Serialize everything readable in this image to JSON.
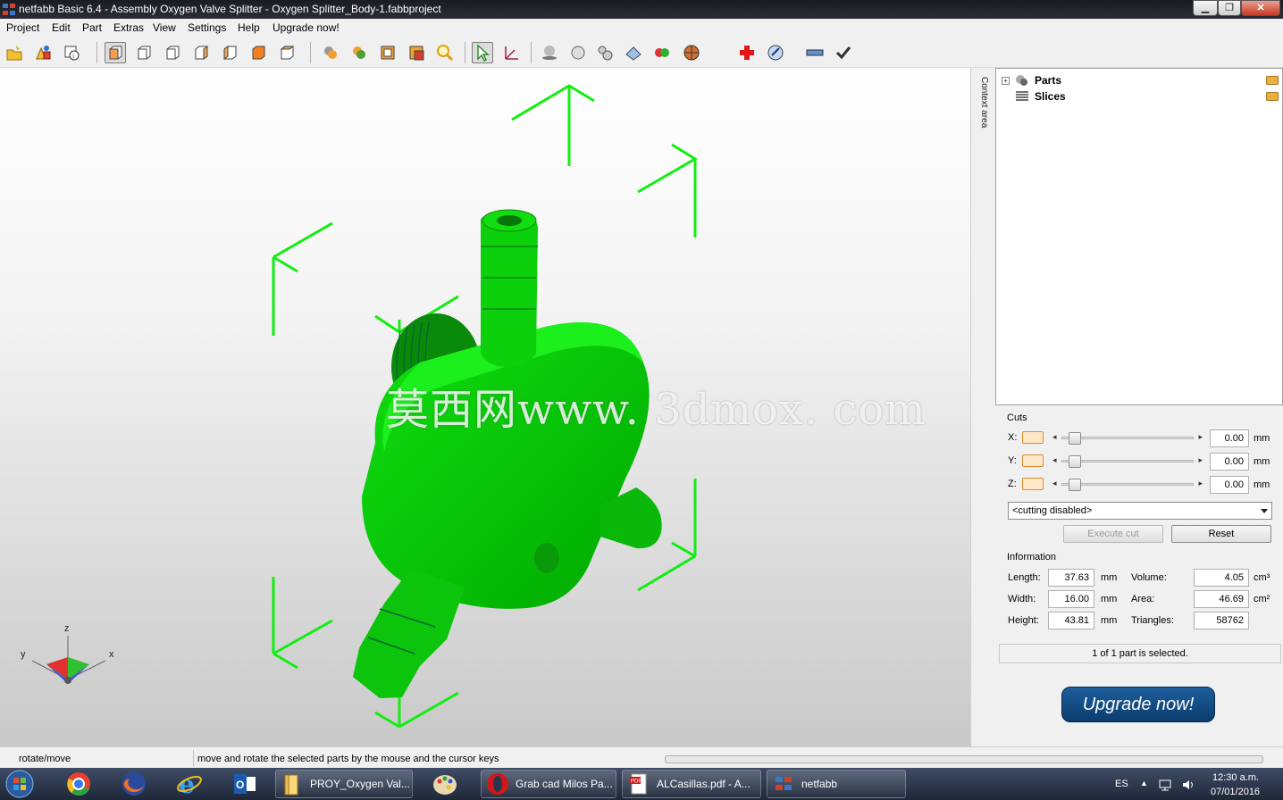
{
  "window": {
    "title": "netfabb Basic 6.4 - Assembly Oxygen Valve Splitter - Oxygen Splitter_Body-1.fabbproject",
    "controls": [
      "minimize",
      "maximize",
      "close"
    ]
  },
  "menu": [
    "Project",
    "Edit",
    "Part",
    "Extras",
    "View",
    "Settings",
    "Help",
    "Upgrade now!"
  ],
  "toolbar": {
    "icons": [
      "open-project-icon",
      "add-part-icon",
      "part-info-icon",
      "view-default-icon",
      "view-front-icon",
      "view-back-icon",
      "view-left-icon",
      "view-right-icon",
      "view-top-icon",
      "view-bottom-icon",
      "select-all-icon",
      "select-parts-icon",
      "view-box-icon",
      "view-box-2-icon",
      "zoom-icon",
      "pointer-tool-icon",
      "measure-axis-icon",
      "shading-icon",
      "sphere-icon",
      "spheres-icon",
      "surface-icon",
      "two-spheres-icon",
      "color-wheel-icon",
      "repair-cross-icon",
      "analyze-icon",
      "ruler-icon",
      "checkmark-icon"
    ]
  },
  "viewport": {
    "watermark": "莫西网www. 3dmox. com",
    "axes": {
      "x": "x",
      "y": "y",
      "z": "z"
    },
    "part_color": "#00cc00"
  },
  "context_area": {
    "label": "Context area"
  },
  "tree": {
    "items": [
      {
        "label": "Parts",
        "expander": "+"
      },
      {
        "label": "Slices",
        "expander": ""
      }
    ]
  },
  "cuts": {
    "title": "Cuts",
    "axes": [
      {
        "label": "X:",
        "value": "0.00",
        "unit": "mm"
      },
      {
        "label": "Y:",
        "value": "0.00",
        "unit": "mm"
      },
      {
        "label": "Z:",
        "value": "0.00",
        "unit": "mm"
      }
    ],
    "mode": "<cutting disabled>",
    "execute_label": "Execute cut",
    "reset_label": "Reset"
  },
  "information": {
    "title": "Information",
    "length": {
      "label": "Length:",
      "value": "37.63",
      "unit": "mm"
    },
    "width": {
      "label": "Width:",
      "value": "16.00",
      "unit": "mm"
    },
    "height": {
      "label": "Height:",
      "value": "43.81",
      "unit": "mm"
    },
    "volume": {
      "label": "Volume:",
      "value": "4.05",
      "unit": "cm³"
    },
    "area": {
      "label": "Area:",
      "value": "46.69",
      "unit": "cm²"
    },
    "triangles": {
      "label": "Triangles:",
      "value": "58762"
    }
  },
  "selection_status": "1 of 1 part is selected.",
  "upgrade_button": "Upgrade now!",
  "statusbar": {
    "mode": "rotate/move",
    "hint": "move and rotate the selected parts by the mouse and the cursor keys"
  },
  "taskbar": {
    "windows": [
      {
        "label": "PROY_Oxygen Val..."
      },
      {
        "label": "Grab cad Milos Pa..."
      },
      {
        "label": "ALCasillas.pdf - A..."
      },
      {
        "label": "netfabb"
      }
    ],
    "lang": "ES",
    "time": "12:30 a.m.",
    "date": "07/01/2016"
  }
}
